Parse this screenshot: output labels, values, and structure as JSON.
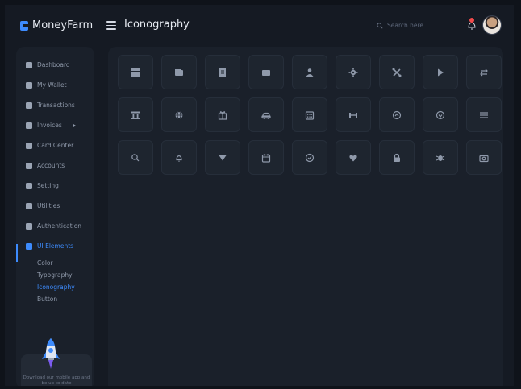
{
  "header": {
    "app_name": "MoneyFarm",
    "page_title": "Iconography",
    "search_placeholder": "Search here ..."
  },
  "sidebar": {
    "items": [
      {
        "label": "Dashboard",
        "icon": "dashboard-icon"
      },
      {
        "label": "My Wallet",
        "icon": "wallet-icon"
      },
      {
        "label": "Transactions",
        "icon": "receipt-icon"
      },
      {
        "label": "Invoices",
        "icon": "invoice-icon",
        "has_submenu": true
      },
      {
        "label": "Card Center",
        "icon": "card-icon"
      },
      {
        "label": "Accounts",
        "icon": "user-icon"
      },
      {
        "label": "Setting",
        "icon": "gear-icon"
      },
      {
        "label": "Utilities",
        "icon": "tools-icon"
      },
      {
        "label": "Authentication",
        "icon": "lock-icon"
      },
      {
        "label": "UI Elements",
        "icon": "list-icon",
        "active": true
      }
    ],
    "sub_items": [
      {
        "label": "Color"
      },
      {
        "label": "Typography"
      },
      {
        "label": "Iconography",
        "active": true
      },
      {
        "label": "Button"
      }
    ],
    "promo_text": "Download our mobile app and be up to date"
  },
  "icon_grid": [
    [
      "dashboard-icon",
      "wallet-icon",
      "receipt-icon",
      "card-icon",
      "user-icon",
      "gear-icon",
      "tools-icon",
      "play-icon",
      "swap-icon"
    ],
    [
      "bank-icon",
      "globe-icon",
      "gift-icon",
      "car-icon",
      "calendar-grid-icon",
      "dumbbell-icon",
      "clock-up-icon",
      "download-circle-icon",
      "menu-icon"
    ],
    [
      "search-icon",
      "bell-icon",
      "triangle-down-icon",
      "calendar-icon",
      "check-circle-icon",
      "heart-icon",
      "lock-icon",
      "bug-icon",
      "camera-icon"
    ]
  ],
  "colors": {
    "accent": "#3d8bfd",
    "background": "#151a23",
    "panel": "#1a202a"
  }
}
